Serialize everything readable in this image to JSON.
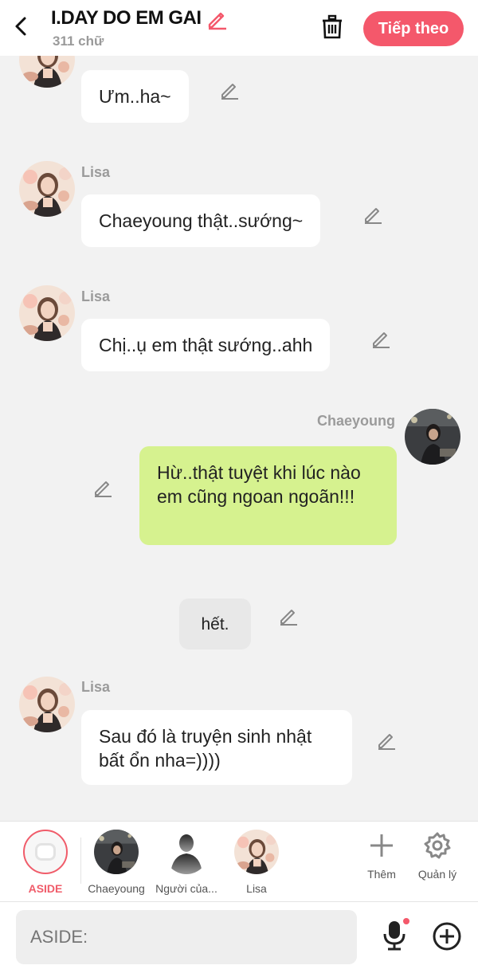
{
  "header": {
    "title": "I.DAY DO EM GAI",
    "word_count": "311 chữ",
    "next_label": "Tiếp theo",
    "accent_color": "#f4586b"
  },
  "messages": [
    {
      "sender": "",
      "text": "Ưm..ha~",
      "side": "left"
    },
    {
      "sender": "Lisa",
      "text": "Chaeyoung thật..sướng~",
      "side": "left"
    },
    {
      "sender": "Lisa",
      "text": "Chị..ụ em thật sướng..ahh",
      "side": "left"
    },
    {
      "sender": "Chaeyoung",
      "text": "Hừ..thật tuyệt khi lúc nào em cũng ngoan ngoãn!!!",
      "side": "right"
    },
    {
      "sender": "",
      "text": "hết.",
      "side": "aside"
    },
    {
      "sender": "Lisa",
      "text": "Sau đó là truyện sinh nhật bất ổn nha=))))",
      "side": "left"
    }
  ],
  "characters": [
    {
      "name": "ASIDE",
      "selected": true
    },
    {
      "name": "Chaeyoung"
    },
    {
      "name": "Người của..."
    },
    {
      "name": "Lisa"
    }
  ],
  "tools": {
    "add_label": "Thêm",
    "manage_label": "Quản lý"
  },
  "input": {
    "placeholder": "ASIDE:"
  },
  "icons": [
    "back-arrow-icon",
    "pencil-icon",
    "trash-icon",
    "plus-icon",
    "gear-icon",
    "microphone-icon",
    "plus-circle-icon"
  ]
}
